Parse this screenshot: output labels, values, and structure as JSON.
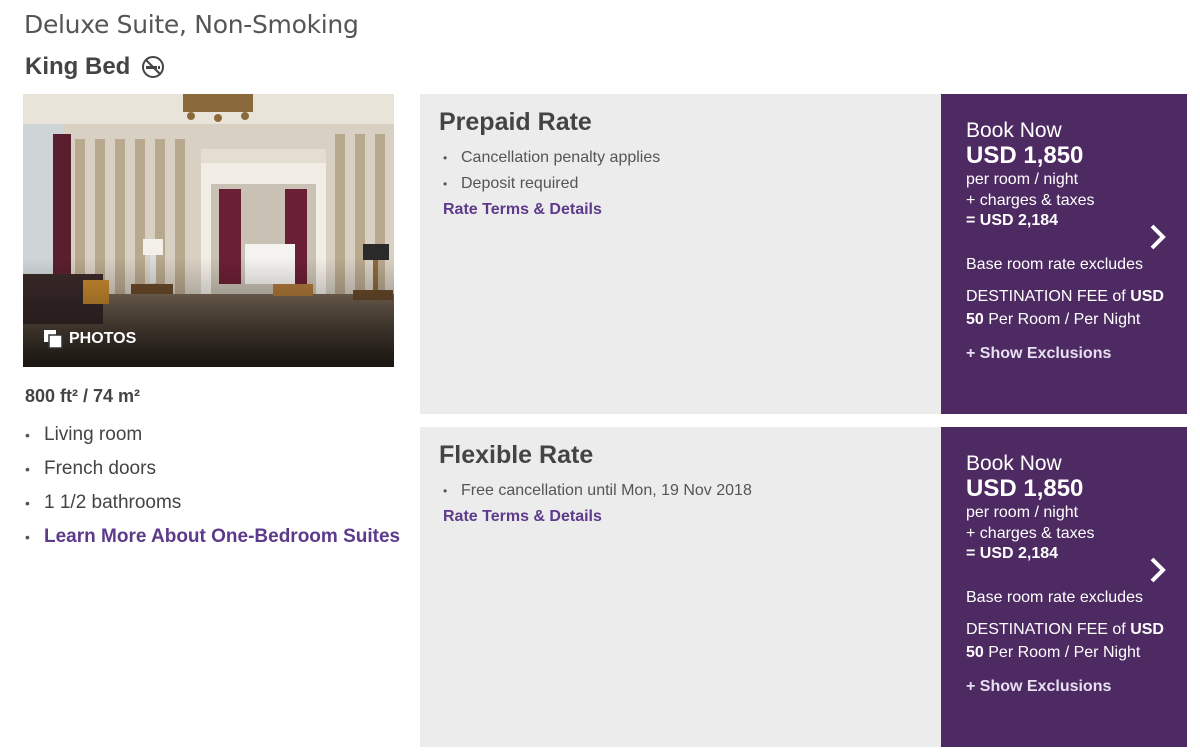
{
  "room": {
    "title": "Deluxe Suite, Non-Smoking",
    "bed_type": "King Bed",
    "photos_label": "PHOTOS",
    "size": "800 ft² / 74 m²",
    "features": [
      "Living room",
      "French doors",
      "1 1/2 bathrooms"
    ],
    "learn_more": "Learn More About One-Bedroom Suites",
    "icons": {
      "smoking": "no-smoking-icon",
      "photos": "photos-icon"
    }
  },
  "rates": [
    {
      "name": "Prepaid Rate",
      "bullets": [
        "Cancellation penalty applies",
        "Deposit required"
      ],
      "terms_link": "Rate Terms & Details",
      "book": {
        "label": "Book Now",
        "price": "USD 1,850",
        "per": "per room / night",
        "charges": "+ charges & taxes",
        "total": "= USD 2,184",
        "base_excludes": "Base room rate excludes",
        "fee_prefix": "DESTINATION FEE of",
        "fee_amount": "USD 50",
        "fee_suffix": "Per Room / Per Night",
        "show_exclusions": "+ Show Exclusions"
      }
    },
    {
      "name": "Flexible Rate",
      "bullets": [
        "Free cancellation until Mon, 19 Nov 2018"
      ],
      "terms_link": "Rate Terms & Details",
      "book": {
        "label": "Book Now",
        "price": "USD 1,850",
        "per": "per room / night",
        "charges": "+ charges & taxes",
        "total": "= USD 2,184",
        "base_excludes": "Base room rate excludes",
        "fee_prefix": "DESTINATION FEE of",
        "fee_amount": "USD 50",
        "fee_suffix": "Per Room / Per Night",
        "show_exclusions": "+ Show Exclusions"
      }
    }
  ],
  "colors": {
    "accent_purple": "#4e2a62",
    "link_purple": "#5d3a8a",
    "panel_gray": "#ececec"
  }
}
